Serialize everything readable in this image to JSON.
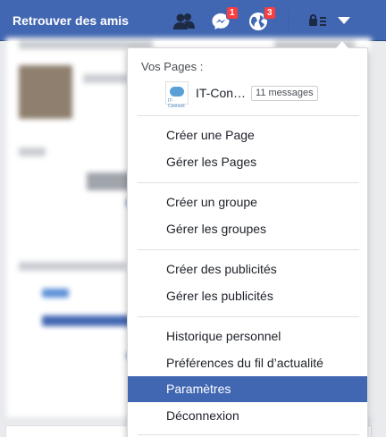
{
  "topbar": {
    "title": "Retrouver des amis",
    "messages_badge": "1",
    "notifications_badge": "3",
    "icons": [
      "friends-icon",
      "messenger-icon",
      "globe-icon",
      "privacy-lock-icon",
      "chevron-down-icon"
    ],
    "color": "#4267b2"
  },
  "menu": {
    "pages_header": "Vos Pages :",
    "page_name": "IT-Con…",
    "page_messages": "11 messages",
    "items_group1": [
      "Créer une Page",
      "Gérer les Pages"
    ],
    "items_group2": [
      "Créer un groupe",
      "Gérer les groupes"
    ],
    "items_group3": [
      "Créer des publicités",
      "Gérer les publicités"
    ],
    "items_group4": [
      "Historique personnel",
      "Préférences du fil d’actualité",
      "Paramètres",
      "Déconnexion"
    ],
    "active_item": "Paramètres",
    "highlight_color": "#4267b2"
  }
}
